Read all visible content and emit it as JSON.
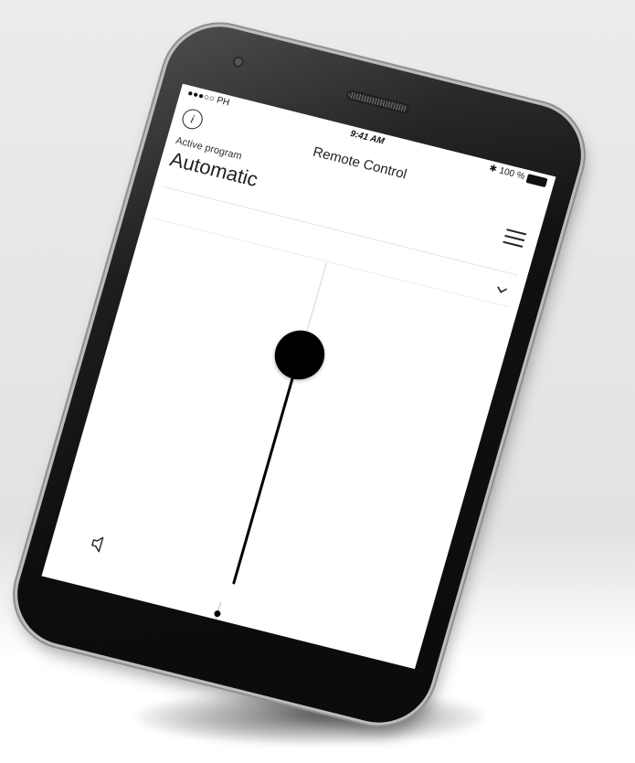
{
  "status_bar": {
    "carrier": "●●●○○ PH",
    "time": "9:41 AM",
    "battery": "100 %"
  },
  "header": {
    "title": "Remote Control",
    "info_icon": "i"
  },
  "program": {
    "label": "Active program",
    "value": "Automatic"
  },
  "icons": {
    "info": "info-icon",
    "menu": "menu-icon",
    "chevron": "chevron-down-icon",
    "speaker": "speaker-icon",
    "settings": "sliders-icon"
  },
  "controls": {
    "volume_level": 0.75
  },
  "colors": {
    "thumb": "#000000",
    "screen": "#ffffff",
    "phone_body": "#111111"
  }
}
